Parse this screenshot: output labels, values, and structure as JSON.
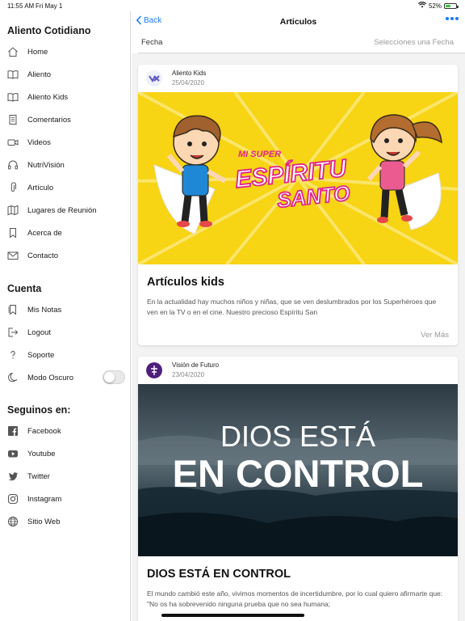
{
  "status_bar": {
    "time": "11:55 AM",
    "date": "Fri May 1",
    "battery_text": "52%",
    "battery_level": 0.52
  },
  "sidebar": {
    "title": "Aliento Cotidiano",
    "menu": [
      {
        "label": "Home",
        "icon": "house-icon"
      },
      {
        "label": "Aliento",
        "icon": "book-icon"
      },
      {
        "label": "Aliento Kids",
        "icon": "book-icon"
      },
      {
        "label": "Comentarios",
        "icon": "document-icon"
      },
      {
        "label": "Videos",
        "icon": "video-camera-icon"
      },
      {
        "label": "NutriVisión",
        "icon": "headphones-icon"
      },
      {
        "label": "Artículo",
        "icon": "paperclip-icon"
      },
      {
        "label": "Lugares de Reunión",
        "icon": "map-icon"
      },
      {
        "label": "Acerca de",
        "icon": "bookmark-icon"
      },
      {
        "label": "Contacto",
        "icon": "envelope-icon"
      }
    ],
    "account_title": "Cuenta",
    "account": [
      {
        "label": "Mis Notas",
        "icon": "bookmark-list-icon"
      },
      {
        "label": "Logout",
        "icon": "logout-icon"
      },
      {
        "label": "Soporte",
        "icon": "question-icon"
      },
      {
        "label": "Modo Oscuro",
        "icon": "moon-icon",
        "toggle_on": false
      }
    ],
    "social_title": "Seguinos en:",
    "social": [
      {
        "label": "Facebook",
        "icon": "facebook-icon"
      },
      {
        "label": "Youtube",
        "icon": "youtube-icon"
      },
      {
        "label": "Twitter",
        "icon": "twitter-icon"
      },
      {
        "label": "Instagram",
        "icon": "instagram-icon"
      },
      {
        "label": "Sitio Web",
        "icon": "globe-icon"
      }
    ]
  },
  "nav": {
    "back_label": "Back",
    "title": "Articulos",
    "more_icon": "ellipsis-icon"
  },
  "filter": {
    "label": "Fecha",
    "value": "Selecciones una Fecha"
  },
  "articles": [
    {
      "author": "Aliento Kids",
      "date": "25/04/2020",
      "image_text_top": "MI SUPER",
      "image_text_main": "ESPÍRITU",
      "image_text_sub": "SANTO",
      "title": "Artículos kids",
      "excerpt": "En la actualidad hay muchos niños y niñas, que se ven deslumbrados por los Superhéroes que ven en la TV o en el cine. Nuestro precioso Espíritu San",
      "more_label": "Ver Más"
    },
    {
      "author": "Visión de Futuro",
      "date": "23/04/2020",
      "image_text_top": "DIOS ESTÁ",
      "image_text_main": "EN CONTROL",
      "title": "DIOS ESTÁ EN CONTROL",
      "excerpt": "El mundo cambió este año, vivimos momentos de incertidumbre, por lo cual quiero afirmarte que: \"No os ha sobrevenido ninguna prueba que no sea humana;"
    }
  ],
  "colors": {
    "accent": "#1a7cf6",
    "kids_yellow": "#f7d414",
    "vision_purple": "#4d1f7a"
  }
}
